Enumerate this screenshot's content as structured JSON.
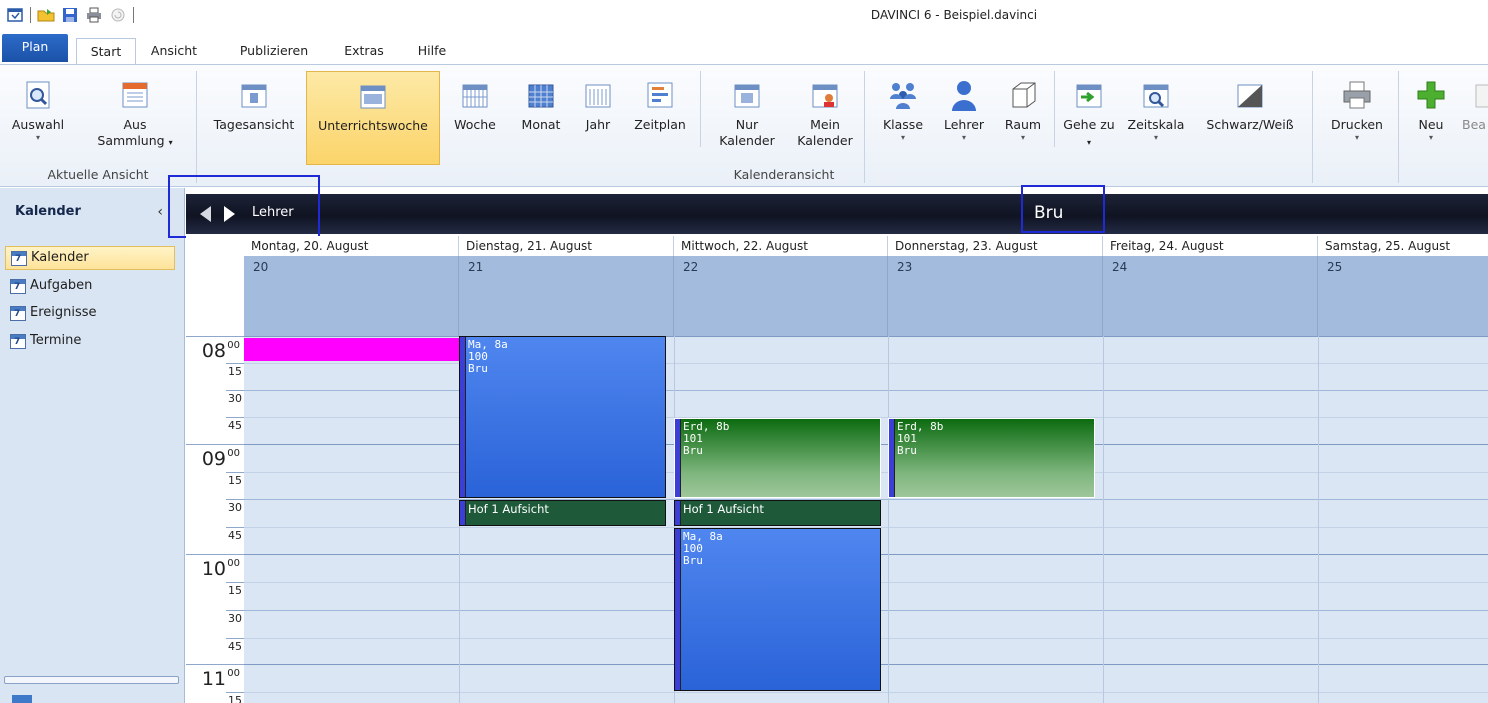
{
  "app": {
    "title": "DAVINCI 6 - Beispiel.davinci"
  },
  "quick_access": [
    "app-icon",
    "open-folder-icon",
    "save-icon",
    "print-icon",
    "refresh-icon"
  ],
  "tabs": [
    {
      "label": "Plan"
    },
    {
      "label": "Start"
    },
    {
      "label": "Ansicht"
    },
    {
      "label": "Publizieren"
    },
    {
      "label": "Extras"
    },
    {
      "label": "Hilfe"
    }
  ],
  "ribbon": {
    "auswahl": "Auswahl",
    "aus_sammlung_1": "Aus",
    "aus_sammlung_2": "Sammlung",
    "group_aktuelle_ansicht": "Aktuelle Ansicht",
    "tagesansicht": "Tagesansicht",
    "unterrichtswoche": "Unterrichtswoche",
    "woche": "Woche",
    "monat": "Monat",
    "jahr": "Jahr",
    "zeitplan": "Zeitplan",
    "nur_1": "Nur",
    "nur_2": "Kalender",
    "mein_1": "Mein",
    "mein_2": "Kalender",
    "group_kalenderansicht": "Kalenderansicht",
    "klasse": "Klasse",
    "lehrer": "Lehrer",
    "raum": "Raum",
    "gehe_1": "Gehe",
    "gehe_2": "zu",
    "zeitskala": "Zeitskala",
    "schwarzweiss": "Schwarz/Weiß",
    "drucken": "Drucken",
    "neu": "Neu",
    "bea": "Bea",
    "arrow": "▾"
  },
  "leftpane": {
    "header": "Kalender",
    "chevron": "‹",
    "items": [
      {
        "label": "Kalender",
        "selected": true
      },
      {
        "label": "Aufgaben"
      },
      {
        "label": "Ereignisse"
      },
      {
        "label": "Termine"
      }
    ]
  },
  "navigator": {
    "label": "Lehrer",
    "current": "Bru"
  },
  "calendar": {
    "days": [
      {
        "header": "Montag, 20. August",
        "num": "20"
      },
      {
        "header": "Dienstag, 21. August",
        "num": "21"
      },
      {
        "header": "Mittwoch, 22. August",
        "num": "22"
      },
      {
        "header": "Donnerstag, 23. August",
        "num": "23"
      },
      {
        "header": "Freitag, 24. August",
        "num": "24"
      },
      {
        "header": "Samstag, 25. August",
        "num": "25"
      }
    ],
    "hours": [
      {
        "hour": "08",
        "min": "00"
      },
      {
        "hour": "09",
        "min": "00"
      },
      {
        "hour": "10",
        "min": "00"
      },
      {
        "hour": "11",
        "min": "00"
      }
    ],
    "quarters": [
      "15",
      "30",
      "45"
    ],
    "events": {
      "e1": {
        "l1": "Ma, 8a",
        "l2": "100",
        "l3": "Bru"
      },
      "e2": {
        "l1": "Erd, 8b",
        "l2": "101",
        "l3": "Bru"
      },
      "e3": {
        "l1": "Erd, 8b",
        "l2": "101",
        "l3": "Bru"
      },
      "e4": {
        "l1": "Hof 1 Aufsicht"
      },
      "e5": {
        "l1": "Hof 1 Aufsicht"
      },
      "e6": {
        "l1": "Ma, 8a",
        "l2": "100",
        "l3": "Bru"
      }
    },
    "colors": {
      "pink": "#ff00ff",
      "blue": "#3a72e3",
      "green": "#0c6b10",
      "hof": "#1e5a3a"
    }
  }
}
